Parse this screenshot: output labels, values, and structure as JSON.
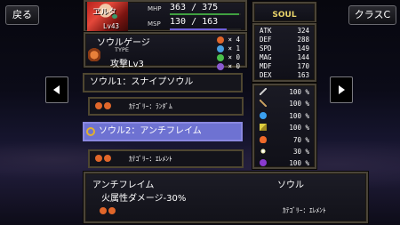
{
  "nav": {
    "back_label": "戻る",
    "class_label": "クラスC"
  },
  "character": {
    "name": "ヱルタ",
    "level": "Lv43",
    "mhp_label": "MHP",
    "mhp": "363 / 375",
    "msp_label": "MSP",
    "msp": "130 / 163"
  },
  "soul_tab": "SOUL",
  "gauge": {
    "title": "ソウルゲージ",
    "type_label": "TYPE",
    "type_value": "攻撃Lv3",
    "orbs": [
      {
        "color": "#e0662a",
        "count": "× 4"
      },
      {
        "color": "#4aa0e0",
        "count": "× 1"
      },
      {
        "color": "#4ac04a",
        "count": "× 0"
      },
      {
        "color": "#8a5ad0",
        "count": "× 0"
      }
    ]
  },
  "stats": [
    {
      "label": "ATK",
      "value": "324"
    },
    {
      "label": "DEF",
      "value": "288"
    },
    {
      "label": "SPD",
      "value": "149"
    },
    {
      "label": "MAG",
      "value": "144"
    },
    {
      "label": "MDF",
      "value": "170"
    },
    {
      "label": "DEX",
      "value": "163"
    }
  ],
  "resists": [
    {
      "icon": "sword-icon",
      "value": "100 %"
    },
    {
      "icon": "spear-icon",
      "value": "100 %"
    },
    {
      "icon": "water-icon",
      "value": "100 %"
    },
    {
      "icon": "lightning-icon",
      "value": "100 %"
    },
    {
      "icon": "fire-icon",
      "value": "70 %"
    },
    {
      "icon": "light-icon",
      "value": "30 %"
    },
    {
      "icon": "dark-icon",
      "value": "100 %"
    }
  ],
  "soul_slots": [
    {
      "label": "ソウル1：スナイプソウル",
      "category": "ｶﾃｺﾞﾘｰ：ﾗﾝﾀﾞﾑ",
      "selected": false
    },
    {
      "label": "ソウル2：アンチフレイム",
      "category": "ｶﾃｺﾞﾘｰ：ｴﾚﾒﾝﾄ",
      "selected": true
    }
  ],
  "detail": {
    "name": "アンチフレイム",
    "kind": "ソウル",
    "effect": "火属性ダメージ-30%",
    "category": "ｶﾃｺﾞﾘｰ：ｴﾚﾒﾝﾄ"
  },
  "colors": {
    "accent_selected": "#6e72d2",
    "panel_border": "#4a4438",
    "mp_bar": "#7060d8",
    "hp_bar": "#40a040",
    "orb_fire": "#e0662a"
  }
}
